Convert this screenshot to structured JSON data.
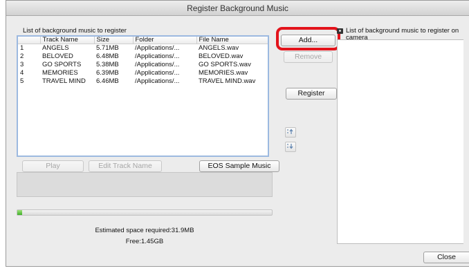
{
  "window": {
    "title": "Register Background Music"
  },
  "left": {
    "list_label": "List of background music to register",
    "columns": [
      "",
      "Track Name",
      "Size",
      "Folder",
      "File Name"
    ],
    "rows": [
      [
        "1",
        "ANGELS",
        "5.71MB",
        "/Applications/...",
        "ANGELS.wav"
      ],
      [
        "2",
        "BELOVED",
        "6.48MB",
        "/Applications/...",
        "BELOVED.wav"
      ],
      [
        "3",
        "GO SPORTS",
        "5.38MB",
        "/Applications/...",
        "GO SPORTS.wav"
      ],
      [
        "4",
        "MEMORIES",
        "6.39MB",
        "/Applications/...",
        "MEMORIES.wav"
      ],
      [
        "5",
        "TRAVEL MIND",
        "6.46MB",
        "/Applications/...",
        "TRAVEL MIND.wav"
      ]
    ],
    "play_label": "Play",
    "edit_label": "Edit Track Name",
    "sample_label": "EOS Sample Music",
    "capacity_used_fraction": 0.02,
    "estimated_text": "Estimated space required:31.9MB",
    "free_text": "Free:1.45GB"
  },
  "middle": {
    "add_label": "Add...",
    "remove_label": "Remove",
    "register_label": "Register",
    "move_up_icon": "move-up-icon",
    "move_down_icon": "move-down-icon"
  },
  "right": {
    "camera_icon": "camera-icon",
    "list_label_line1": "List of background music to register on",
    "list_label_line2": "camera",
    "close_label": "Close"
  },
  "colors": {
    "highlight": "#e3131b",
    "selection_border": "#9cb9e0",
    "capacity_fill": "#3fae29"
  }
}
